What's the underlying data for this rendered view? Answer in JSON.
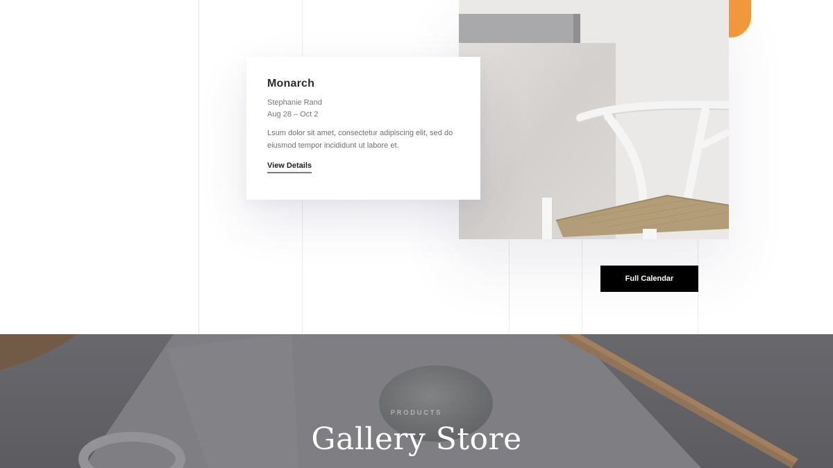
{
  "event": {
    "title": "Monarch",
    "artist": "Stephanie Rand",
    "dates": "Aug 28 – Oct 2",
    "description": "Lsum dolor sit amet, consectetur adipiscing elit, sed do eiusmod tempor incididunt ut labore et.",
    "link_label": "View Details"
  },
  "calendar_button_label": "Full Calendar",
  "hero": {
    "eyebrow": "PRODUCTS",
    "title": "Gallery Store"
  },
  "colors": {
    "accent": "#f39a3c",
    "button_bg": "#000000",
    "hero_overlay": "#6b6b6f"
  }
}
